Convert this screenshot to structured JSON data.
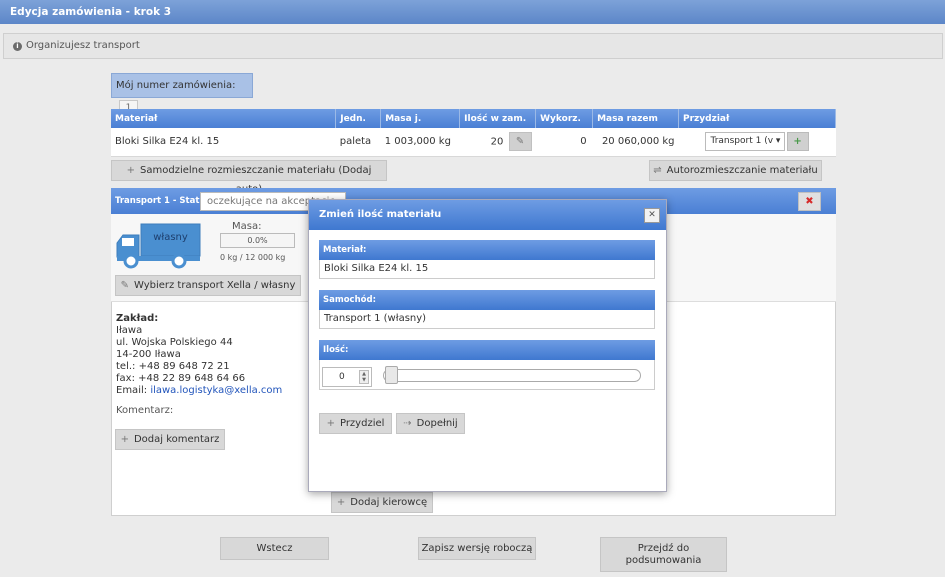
{
  "window": {
    "title": "Edycja zamówienia - krok 3"
  },
  "info": {
    "text": "Organizujesz transport",
    "icon": "info-icon"
  },
  "order": {
    "label": "Mój numer zamówienia:",
    "value": "1"
  },
  "materials_table": {
    "headers": [
      "Materiał",
      "Jedn.",
      "Masa j.",
      "Ilość w zam.",
      "Wykorz.",
      "Masa razem",
      "Przydział"
    ],
    "rows": [
      {
        "material": "Bloki Silka E24 kl. 15",
        "unit": "paleta",
        "unit_mass": "1 003,000 kg",
        "quantity": "20",
        "used": "0",
        "total_mass": "20 060,000 kg",
        "assignment": "Transport 1 (v"
      }
    ]
  },
  "actions": {
    "auto_add": "Samodzielne rozmieszczanie materiału (Dodaj auto)",
    "auto_place": "Autorozmieszczanie materiału"
  },
  "transport": {
    "header": "Transport 1 - Status:",
    "status": "oczekujące na akceptację",
    "truck_label": "własny",
    "mass_label": "Masa:",
    "mass_percent": "0.0%",
    "mass_value": "0 kg / 12 000 kg",
    "choose_button": "Wybierz transport Xella / własny",
    "plant_label": "Zakład:",
    "plant_lines": [
      "Iława",
      "ul. Wojska Polskiego 44",
      "14-200 Iława",
      "tel.: +48 89 648 72 21",
      "fax: +48 22 89 648 64 66"
    ],
    "email_label": "Email:",
    "email": "ilawa.logistyka@xella.com",
    "comment_label": "Komentarz:",
    "add_comment": "Dodaj komentarz",
    "add_driver": "Dodaj kierowcę"
  },
  "modal": {
    "title": "Zmień ilość materiału",
    "material_label": "Materiał:",
    "material_value": "Bloki Silka E24 kl. 15",
    "vehicle_label": "Samochód:",
    "vehicle_value": "Transport 1 (własny)",
    "quantity_label": "Ilość:",
    "quantity_value": "0",
    "assign_button": "Przydziel",
    "fill_button": "Dopełnij"
  },
  "footer": {
    "back": "Wstecz",
    "save_draft": "Zapisz wersję roboczą",
    "summary_line1": "Przejdź do",
    "summary_line2": "podsumowania"
  },
  "colors": {
    "accent": "#4a7fd4",
    "header": "#5c86c8",
    "truck": "#4a8fd0"
  }
}
